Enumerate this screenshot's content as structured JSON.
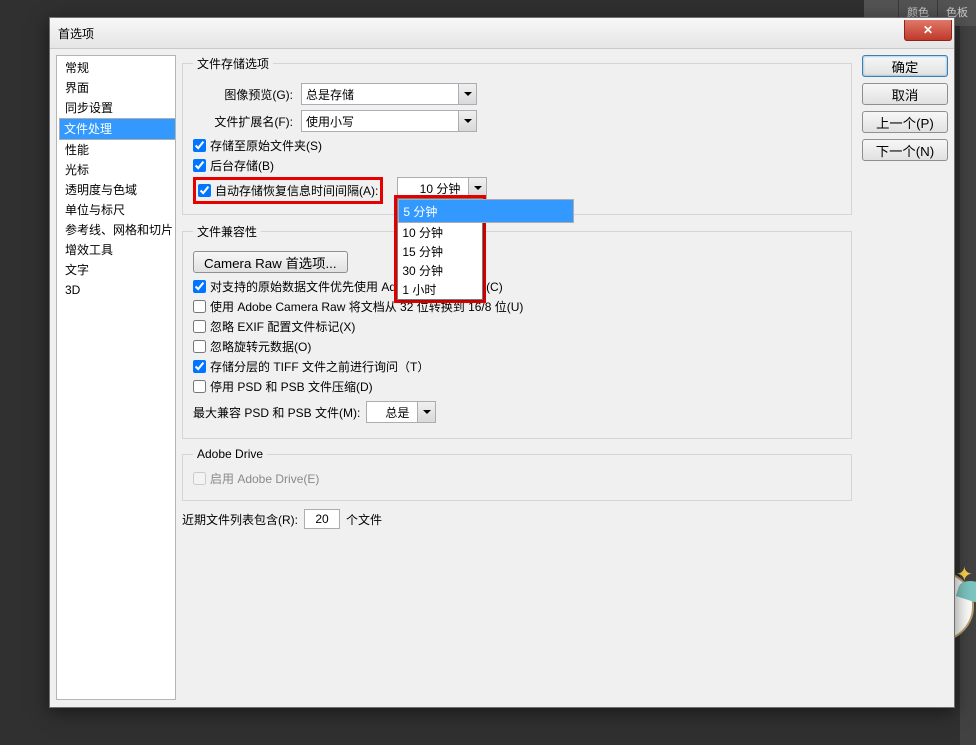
{
  "background_tabs": [
    "颜色",
    "色板"
  ],
  "dialog": {
    "title": "首选项",
    "close_icon": "✕"
  },
  "sidebar": {
    "items": [
      "常规",
      "界面",
      "同步设置",
      "文件处理",
      "性能",
      "光标",
      "透明度与色域",
      "单位与标尺",
      "参考线、网格和切片",
      "增效工具",
      "文字",
      "3D"
    ],
    "selected_index": 3
  },
  "buttons": {
    "ok": "确定",
    "cancel": "取消",
    "prev": "上一个(P)",
    "next": "下一个(N)"
  },
  "group_storage": {
    "legend": "文件存储选项",
    "image_preview_label": "图像预览(G):",
    "image_preview_value": "总是存储",
    "file_ext_label": "文件扩展名(F):",
    "file_ext_value": "使用小写",
    "save_to_original": {
      "checked": true,
      "label": "存储至原始文件夹(S)"
    },
    "background_save": {
      "checked": true,
      "label": "后台存储(B)"
    },
    "auto_save": {
      "checked": true,
      "label": "自动存储恢复信息时间间隔(A):",
      "value": "10 分钟"
    },
    "auto_save_options": [
      "5 分钟",
      "10 分钟",
      "15 分钟",
      "30 分钟",
      "1 小时"
    ],
    "auto_save_open_selected": 0
  },
  "group_compat": {
    "legend": "文件兼容性",
    "camera_raw_btn": "Camera Raw 首选项...",
    "prefer_raw": {
      "checked": true,
      "label_pre": "对支持的原始数据文件优先使用 Adob",
      "label_post": "(C)"
    },
    "use_acr_32": {
      "checked": false,
      "label": "使用 Adobe Camera Raw 将文档从 32 位转换到 16/8 位(U)"
    },
    "ignore_exif": {
      "checked": false,
      "label": "忽略 EXIF 配置文件标记(X)"
    },
    "ignore_rotate": {
      "checked": false,
      "label": "忽略旋转元数据(O)"
    },
    "ask_tiff": {
      "checked": true,
      "label": "存储分层的 TIFF 文件之前进行询问（T）"
    },
    "disable_psd_comp": {
      "checked": false,
      "label": "停用 PSD 和 PSB 文件压缩(D)"
    },
    "max_compat_label": "最大兼容 PSD 和 PSB 文件(M):",
    "max_compat_value": "总是"
  },
  "group_drive": {
    "legend": "Adobe Drive",
    "enable": {
      "checked": false,
      "label": "启用 Adobe Drive(E)"
    }
  },
  "recent": {
    "label_pre": "近期文件列表包含(R):",
    "value": "20",
    "label_post": "个文件"
  }
}
